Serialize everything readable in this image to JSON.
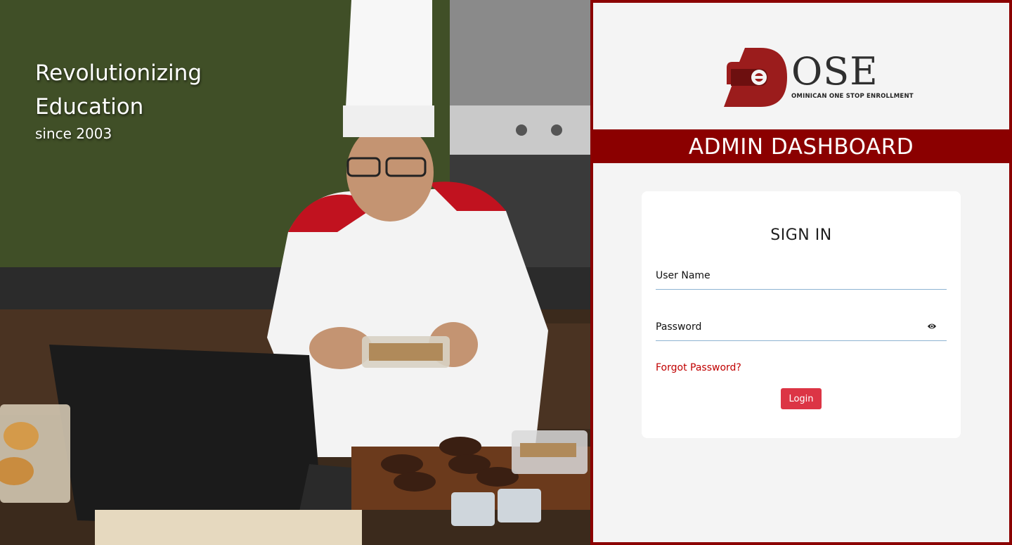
{
  "hero": {
    "title": "Revolutionizing Education",
    "subtitle": "since 2003"
  },
  "brand": {
    "logo_text": "OSE",
    "logo_tagline": "OMINICAN ONE STOP ENROLLMENT",
    "colors": {
      "maroon": "#8b0000",
      "button": "#dc3545",
      "link": "#c00000"
    }
  },
  "banner": {
    "title": "ADMIN DASHBOARD"
  },
  "signin": {
    "title": "SIGN IN",
    "username_label": "User Name",
    "password_label": "Password",
    "password_toggle_icon": "eye-icon",
    "forgot_label": "Forgot Password?",
    "login_label": "Login"
  }
}
